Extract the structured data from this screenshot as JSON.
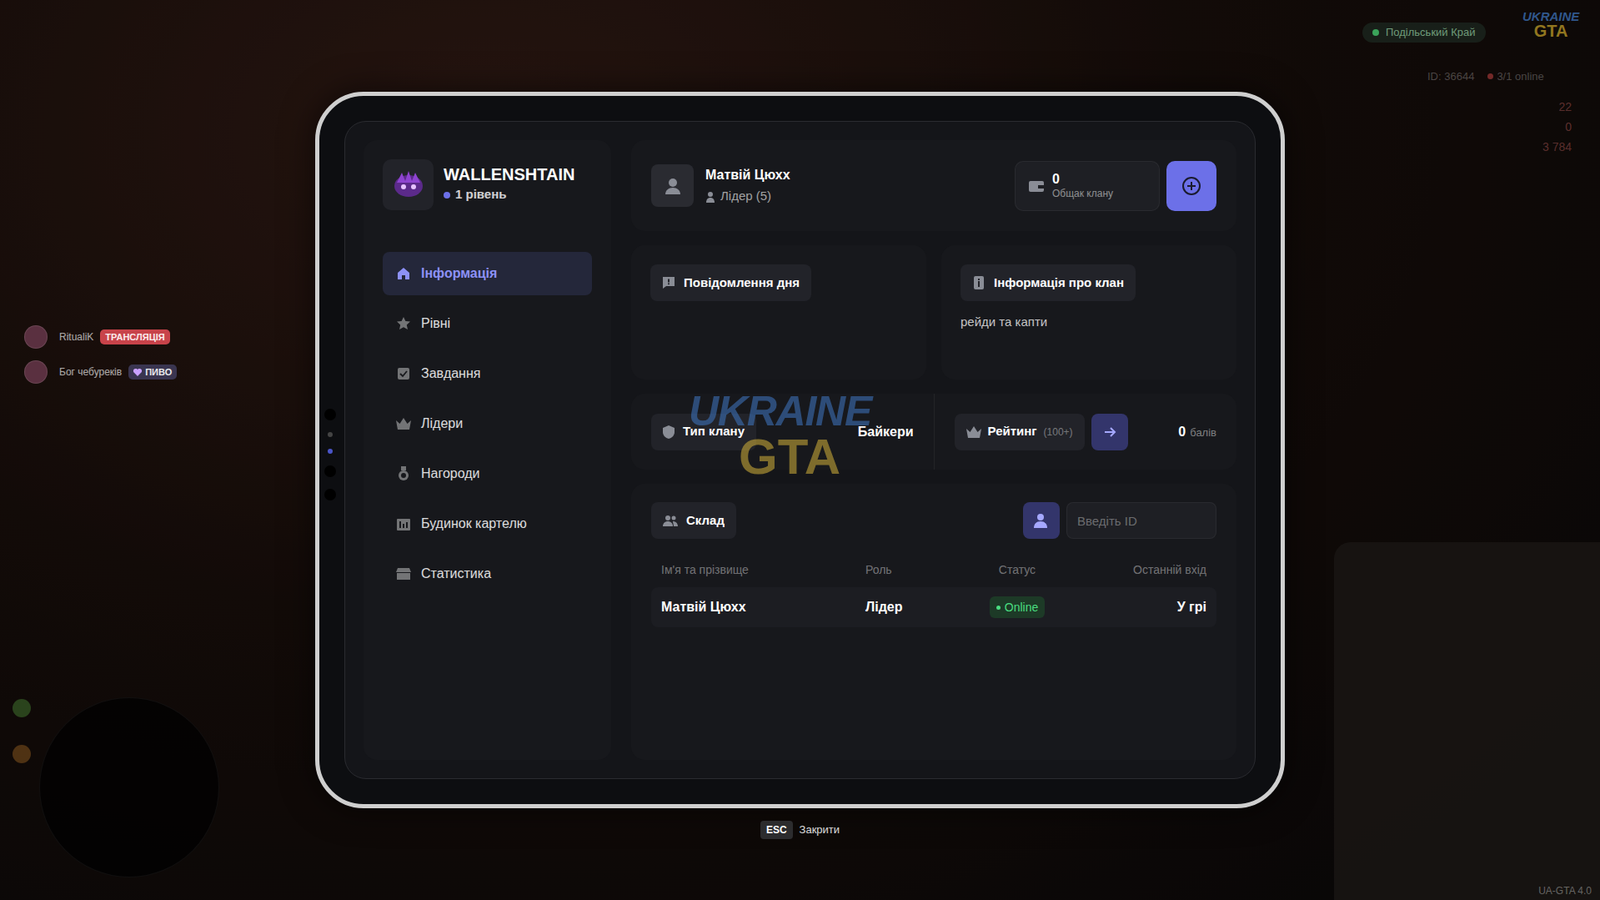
{
  "hud": {
    "server": "Подільський Край",
    "logo_top": "UKRAINE",
    "logo_bottom": "GTA",
    "player_id": "ID: 36644",
    "online": "3/1 online",
    "stats": [
      "22",
      "0",
      "3 784"
    ],
    "version": "UA-GTA 4.0"
  },
  "streams": [
    {
      "name": "RitualiK",
      "badge": "ТРАНСЛЯЦІЯ",
      "color": "#c8434a"
    },
    {
      "name": "Бог чебуреків",
      "badge": "ПИВО",
      "color": "#3a3550"
    }
  ],
  "watermark": {
    "top": "UKRAINE",
    "bottom": "GTA"
  },
  "clan": {
    "name": "WALLENSHTAIN",
    "level": "1 рівень"
  },
  "sidebar": {
    "items": [
      {
        "label": "Інформація",
        "selected": true
      },
      {
        "label": "Рівні",
        "selected": false
      },
      {
        "label": "Завдання",
        "selected": false
      },
      {
        "label": "Лідери",
        "selected": false
      },
      {
        "label": "Нагороди",
        "selected": false
      },
      {
        "label": "Будинок картелю",
        "selected": false
      },
      {
        "label": "Статистика",
        "selected": false
      }
    ]
  },
  "leader": {
    "name": "Матвій Цюхх",
    "role": "Лідер (5)"
  },
  "bank": {
    "amount": "0",
    "label": "Общак клану"
  },
  "motd": {
    "title": "Повідомлення дня"
  },
  "about": {
    "title": "Інформація про клан",
    "text": "рейди та капти"
  },
  "clan_type": {
    "label": "Тип клану",
    "value": "Байкери"
  },
  "rating": {
    "label": "Рейтинг",
    "hint": "(100+)",
    "points": "0",
    "unit": "балів"
  },
  "members": {
    "title": "Склад",
    "search": {
      "placeholder": "Введіть ID"
    },
    "columns": [
      "Ім'я та прізвище",
      "Роль",
      "Статус",
      "Останній вхід"
    ],
    "rows": [
      {
        "name": "Матвій Цюхх",
        "role": "Лідер",
        "status": "Online",
        "online": true,
        "last": "У грі"
      }
    ]
  },
  "footer": {
    "key": "ESC",
    "label": "Закрити"
  }
}
